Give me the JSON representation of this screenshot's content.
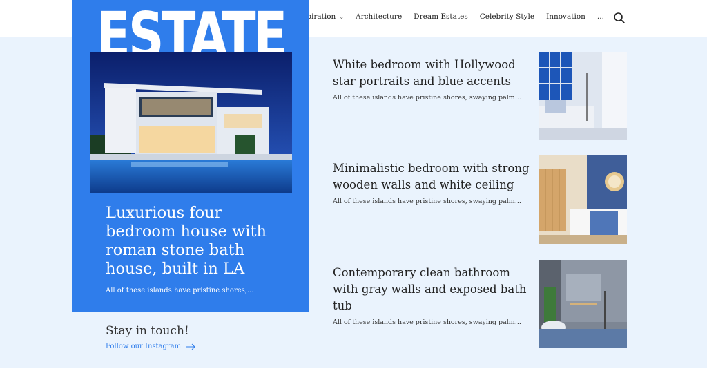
{
  "logo": "ESTATE",
  "nav": {
    "items": [
      "Inspiration",
      "Architecture",
      "Dream Estates",
      "Celebrity Style",
      "Innovation",
      "..."
    ]
  },
  "feature": {
    "title": "Luxurious four bedroom house with roman stone bath house, built in LA",
    "excerpt": "All of these islands have pristine shores,..."
  },
  "contact": {
    "heading": "Stay in touch!",
    "link": "Follow our Instagram"
  },
  "articles": [
    {
      "title": "White bedroom with Hollywood star portraits and blue accents",
      "excerpt": "All of these islands have pristine shores, swaying palm..."
    },
    {
      "title": "Minimalistic bedroom with strong wooden walls and white ceiling",
      "excerpt": "All of these islands have pristine shores, swaying palm..."
    },
    {
      "title": "Contemporary clean bathroom with gray walls and exposed bath tub",
      "excerpt": "All of these islands have pristine shores, swaying palm..."
    }
  ],
  "colors": {
    "accent": "#2f7deb",
    "band": "#eaf3fd"
  },
  "icons": {
    "menu": "hamburger-icon",
    "search": "search-icon",
    "arrow": "arrow-right-icon",
    "chevron": "chevron-down-icon"
  }
}
